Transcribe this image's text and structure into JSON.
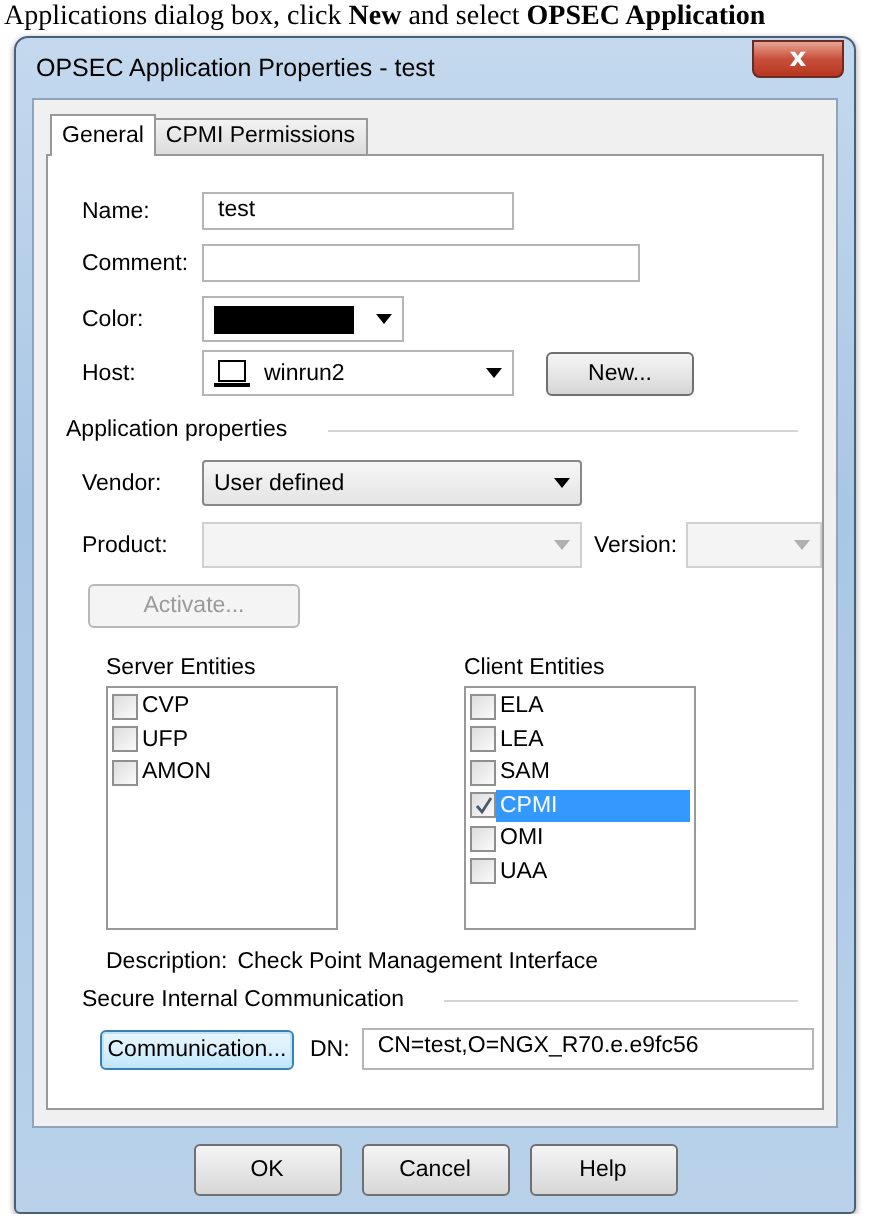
{
  "caption": "Applications dialog box, click **New** and select **OPSEC Application**",
  "window": {
    "title": "OPSEC Application Properties - test",
    "close": "x"
  },
  "tabs": [
    {
      "label": "General",
      "selected": true
    },
    {
      "label": "CPMI Permissions",
      "selected": false
    }
  ],
  "general": {
    "name": {
      "label": "Name:",
      "value": "test"
    },
    "comment": {
      "label": "Comment:"
    },
    "color": {
      "label": "Color:",
      "color": "#000000"
    },
    "host": {
      "label": "Host:",
      "value": "winrun2",
      "button": "New..."
    },
    "application_properties": {
      "title": "Application properties",
      "vendor": {
        "label": "Vendor:",
        "value": "User defined",
        "disabled": false
      },
      "product": {
        "label": "Product:",
        "disabled": true
      },
      "version": {
        "label": "Version:",
        "disabled": true
      },
      "activate": {
        "label": "Activate...",
        "disabled": true
      }
    },
    "server_entities": {
      "title": "Server Entities",
      "items": [
        {
          "label": "CVP",
          "checked": false,
          "selected": false
        },
        {
          "label": "UFP",
          "checked": false,
          "selected": false
        },
        {
          "label": "AMON",
          "checked": false,
          "selected": false
        }
      ]
    },
    "client_entities": {
      "title": "Client Entities",
      "items": [
        {
          "label": "ELA",
          "checked": false,
          "selected": false
        },
        {
          "label": "LEA",
          "checked": false,
          "selected": false
        },
        {
          "label": "SAM",
          "checked": false,
          "selected": false
        },
        {
          "label": "CPMI",
          "checked": true,
          "selected": true
        },
        {
          "label": "OMI",
          "checked": false,
          "selected": false
        },
        {
          "label": "UAA",
          "checked": false,
          "selected": false
        }
      ]
    },
    "description": {
      "label": "Description:",
      "value": "Check Point Management Interface"
    },
    "secure_internal_communication": {
      "title": "Secure Internal Communication",
      "button": "Communication...",
      "dn_label": "DN:",
      "dn": "CN=test,O=NGX_R70.e.e9fc56"
    }
  },
  "buttons": [
    {
      "label": "OK"
    },
    {
      "label": "Cancel"
    },
    {
      "label": "Help"
    }
  ]
}
